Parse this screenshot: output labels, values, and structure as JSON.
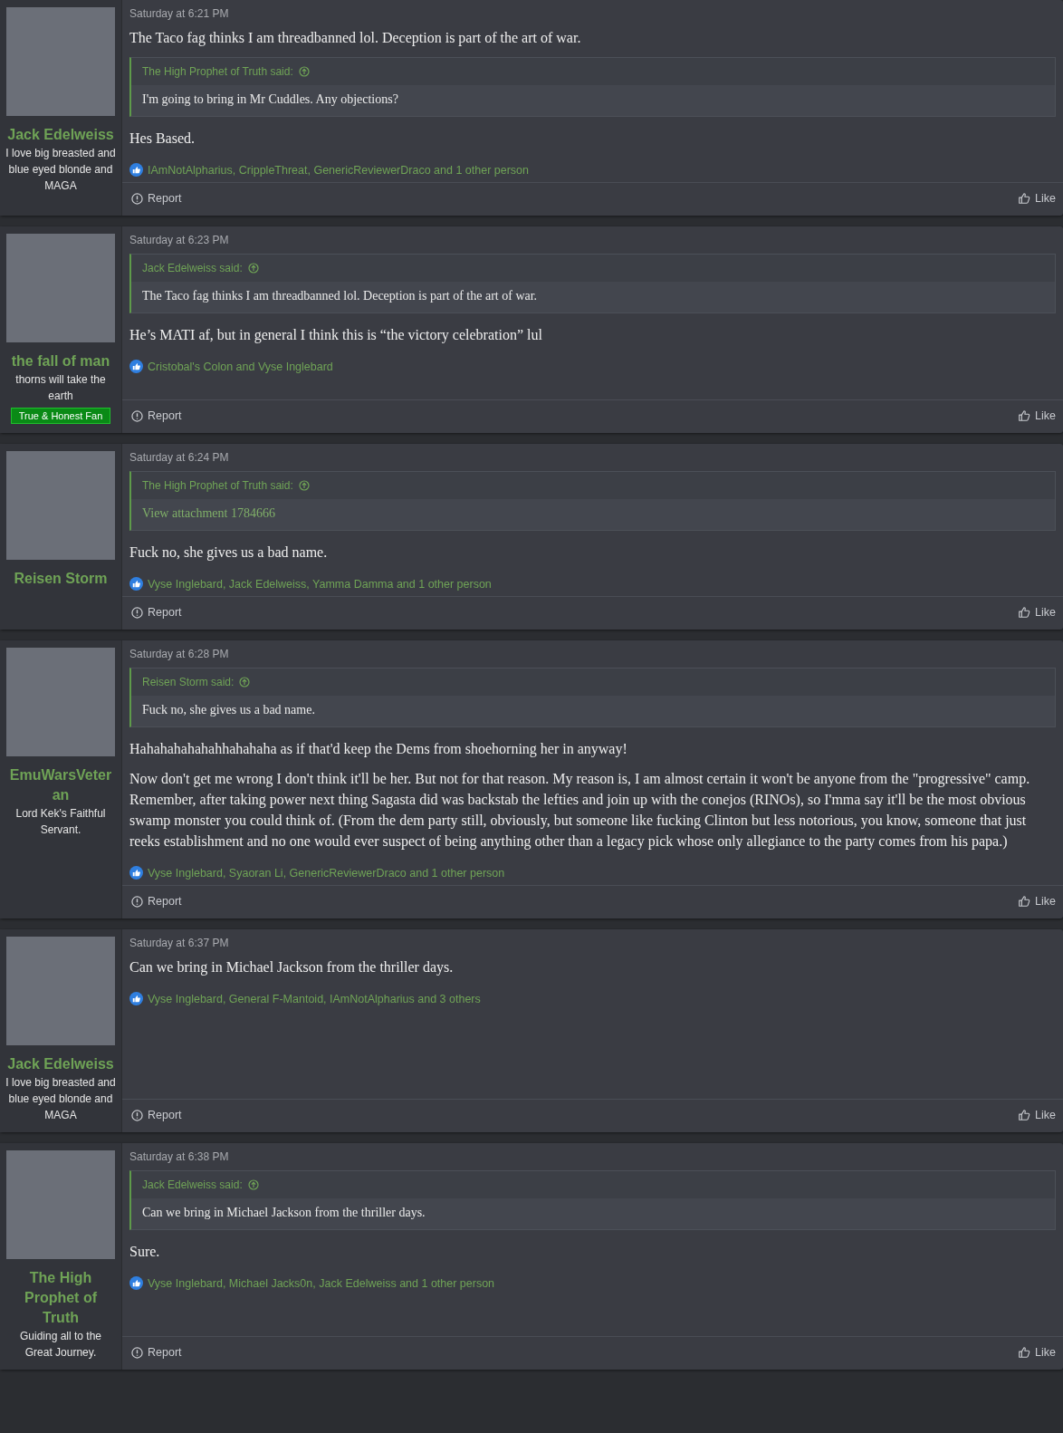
{
  "posts": [
    {
      "author": {
        "name": "Jack Edelweiss",
        "title": "I love big breasted and blue eyed blonde and MAGA"
      },
      "time": "Saturday at 6:21 PM",
      "lead": [
        "The Taco fag thinks I am threadbanned lol. Deception is part of the art of war."
      ],
      "quote": {
        "author": "The High Prophet of Truth said:",
        "kind": "text",
        "text": "I'm going to bring in Mr Cuddles. Any objections?"
      },
      "body": [
        "Hes Based."
      ],
      "likes": "IAmNotAlpharius, CrippleThreat, GenericReviewerDraco and 1 other person",
      "actions": [
        "Report",
        "Like"
      ]
    },
    {
      "author": {
        "name": "the fall of man",
        "title": "thorns will take the earth",
        "banner": "True & Honest Fan"
      },
      "time": "Saturday at 6:23 PM",
      "quote": {
        "author": "Jack Edelweiss said:",
        "kind": "text",
        "text": "The Taco fag thinks I am threadbanned lol. Deception is part of the art of war."
      },
      "body": [
        "He’s MATI af, but in general I think this is “the victory celebration” lul"
      ],
      "likes": "Cristobal's Colon and Vyse Inglebard",
      "actions": [
        "Report",
        "Like"
      ]
    },
    {
      "author": {
        "name": "Reisen Storm"
      },
      "time": "Saturday at 6:24 PM",
      "quote": {
        "author": "The High Prophet of Truth said:",
        "kind": "link",
        "text": "View attachment 1784666"
      },
      "body": [
        "Fuck no, she gives us a bad name."
      ],
      "likes": "Vyse Inglebard, Jack Edelweiss, Yamma Damma and 1 other person",
      "actions": [
        "Report",
        "Like"
      ]
    },
    {
      "author": {
        "name": "EmuWarsVeteran",
        "title": "Lord Kek's Faithful Servant."
      },
      "time": "Saturday at 6:28 PM",
      "quote": {
        "author": "Reisen Storm said:",
        "kind": "text",
        "text": "Fuck no, she gives us a bad name."
      },
      "body": [
        "Hahahahahahahhahahaha as if that'd keep the Dems from shoehorning her in anyway!",
        "Now don't get me wrong I don't think it'll be her. But not for that reason. My reason is, I am almost certain it won't be anyone from the \"progressive\" camp. Remember, after taking power next thing Sagasta did was backstab the lefties and join up with the conejos (RINOs), so I'mma say it'll be the most obvious swamp monster you could think of. (From the dem party still, obviously, but someone like fucking Clinton but less notorious, you know, someone that just reeks establishment and no one would ever suspect of being anything other than a legacy pick whose only allegiance to the party comes from his papa.)"
      ],
      "likes": "Vyse Inglebard, Syaoran Li, GenericReviewerDraco and 1 other person",
      "actions": [
        "Report",
        "Like"
      ]
    },
    {
      "author": {
        "name": "Jack Edelweiss",
        "title": "I love big breasted and blue eyed blonde and MAGA"
      },
      "time": "Saturday at 6:37 PM",
      "body": [
        "Can we bring in Michael Jackson from the thriller days."
      ],
      "likes": "Vyse Inglebard, General F-Mantoid, IAmNotAlpharius and 3 others",
      "actions": [
        "Report",
        "Like"
      ]
    },
    {
      "author": {
        "name": "The High Prophet of Truth",
        "title": "Guiding all to the Great Journey."
      },
      "time": "Saturday at 6:38 PM",
      "quote": {
        "author": "Jack Edelweiss said:",
        "kind": "text",
        "text": "Can we bring in Michael Jackson from the thriller days."
      },
      "body": [
        "Sure."
      ],
      "likes": "Vyse Inglebard, Michael Jacks0n, Jack Edelweiss and 1 other person",
      "actions": [
        "Report",
        "Like"
      ]
    }
  ]
}
